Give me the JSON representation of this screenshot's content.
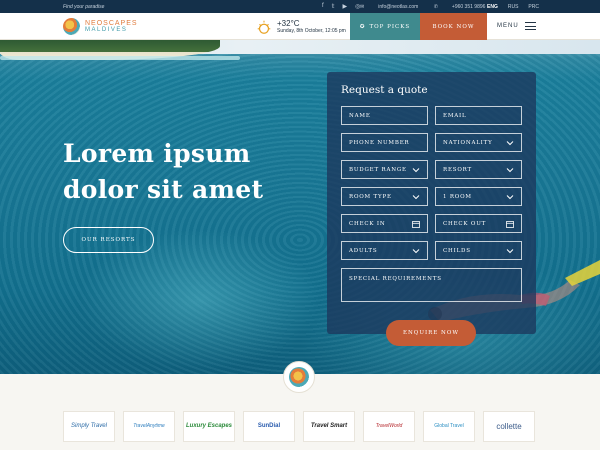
{
  "topbar": {
    "tagline": "Find your paradise",
    "email": "info@neotlas.com",
    "phone": "+960 351 9896",
    "languages": [
      "ENG",
      "RUS",
      "PRC"
    ],
    "active_language": "ENG"
  },
  "brand": {
    "line1": "NEOSCAPES",
    "line2": "MALDIVES"
  },
  "weather": {
    "temperature": "+32°C",
    "date": "Sunday, 8th October, 12:05 pm"
  },
  "header_nav": {
    "top_picks": "TOP PICKS",
    "book_now": "BOOK NOW",
    "menu": "MENU"
  },
  "hero": {
    "title_line1": "Lorem ipsum",
    "title_line2": "dolor sit amet",
    "cta": "OUR RESORTS"
  },
  "quote_form": {
    "title": "Request a quote",
    "fields": {
      "name": "NAME",
      "email": "EMAIL",
      "phone": "PHONE NUMBER",
      "nationality": "NATIONALITY",
      "budget": "BUDGET RANGE",
      "resort": "RESORT",
      "room_type": "ROOM TYPE",
      "rooms": "1 ROOM",
      "check_in": "CHECK IN",
      "check_out": "CHECK OUT",
      "adults": "ADULTS",
      "childs": "CHILDS",
      "special": "SPECIAL REQUIREMENTS"
    },
    "submit": "ENQUIRE NOW"
  },
  "partners": [
    "Simply Travel",
    "TravelAnytime",
    "Luxury Escapes",
    "SunDial",
    "Travel Smart",
    "TravelWorld",
    "Global Travel",
    "collette"
  ],
  "colors": {
    "navy": "#14304a",
    "teal": "#3f8a8e",
    "terracotta": "#c45c36",
    "form_bg": "#1c375c"
  }
}
